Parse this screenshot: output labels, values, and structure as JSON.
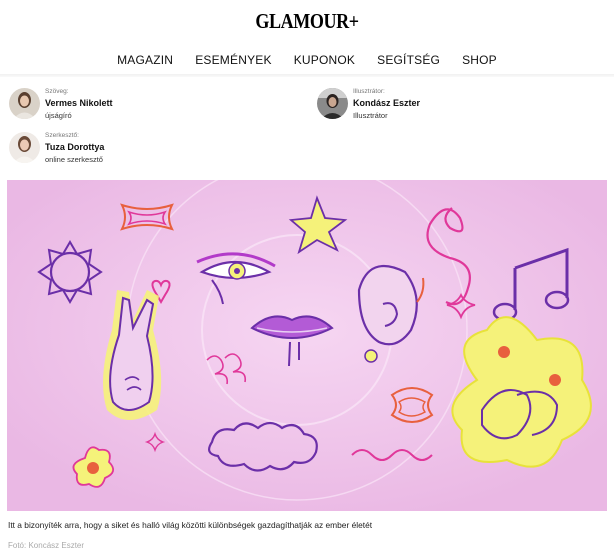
{
  "header": {
    "logo": "GLAMOUR+"
  },
  "nav": [
    {
      "label": "MAGAZIN"
    },
    {
      "label": "ESEMÉNYEK"
    },
    {
      "label": "KUPONOK"
    },
    {
      "label": "SEGÍTSÉG"
    },
    {
      "label": "SHOP"
    }
  ],
  "authors": {
    "writer": {
      "role_top": "Szöveg:",
      "name": "Vermes Nikolett",
      "sub": "újságíró"
    },
    "illustrator": {
      "role_top": "Illusztrátor:",
      "name": "Kondász Eszter",
      "sub": "Illusztrátor"
    },
    "editor": {
      "role_top": "Szerkesztő:",
      "name": "Tuza Dorottya",
      "sub": "online szerkesztő"
    }
  },
  "article": {
    "caption": "Itt a bizonyíték arra, hogy a siket és halló világ közötti különbségek gazdagíthatják az ember életét",
    "credit": "Fotó: Koncász Eszter"
  },
  "colors": {
    "hero_bg": "#eec0e8",
    "purple": "#6b2fa8",
    "yellow": "#f5f27a",
    "orange": "#e8603e",
    "pink": "#e0389a"
  }
}
